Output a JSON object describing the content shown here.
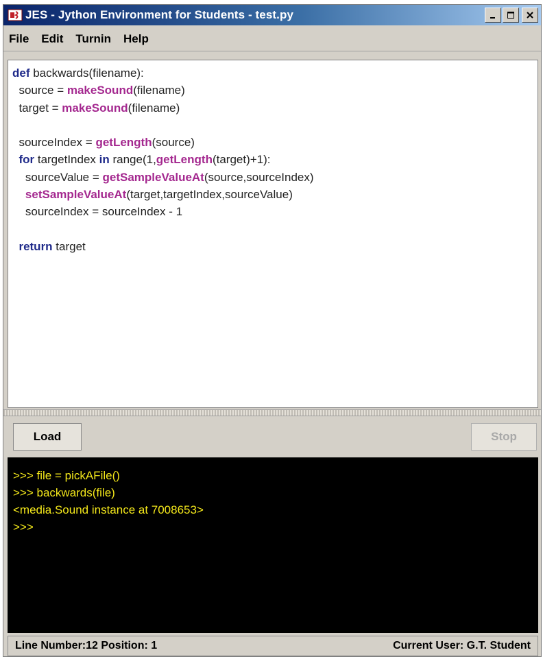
{
  "window": {
    "title": "JES - Jython Environment for Students - test.py",
    "controls": [
      "minimize-icon",
      "maximize-icon",
      "close-icon"
    ]
  },
  "menu": {
    "items": [
      {
        "label": "File"
      },
      {
        "label": "Edit"
      },
      {
        "label": "Turnin"
      },
      {
        "label": "Help"
      }
    ]
  },
  "editor": {
    "lines": [
      [
        {
          "t": "def",
          "s": "kw"
        },
        {
          "t": " backwards(filename):",
          "s": "n"
        }
      ],
      [
        {
          "t": "  source = ",
          "s": "n"
        },
        {
          "t": "makeSound",
          "s": "fn"
        },
        {
          "t": "(filename)",
          "s": "n"
        }
      ],
      [
        {
          "t": "  target = ",
          "s": "n"
        },
        {
          "t": "makeSound",
          "s": "fn"
        },
        {
          "t": "(filename)",
          "s": "n"
        }
      ],
      [
        {
          "t": "",
          "s": "n"
        }
      ],
      [
        {
          "t": "  sourceIndex = ",
          "s": "n"
        },
        {
          "t": "getLength",
          "s": "fn"
        },
        {
          "t": "(source)",
          "s": "n"
        }
      ],
      [
        {
          "t": "  ",
          "s": "n"
        },
        {
          "t": "for",
          "s": "kw"
        },
        {
          "t": " targetIndex ",
          "s": "n"
        },
        {
          "t": "in",
          "s": "kw"
        },
        {
          "t": " range(1,",
          "s": "n"
        },
        {
          "t": "getLength",
          "s": "fn"
        },
        {
          "t": "(target)+1):",
          "s": "n"
        }
      ],
      [
        {
          "t": "    sourceValue = ",
          "s": "n"
        },
        {
          "t": "getSampleValueAt",
          "s": "fn"
        },
        {
          "t": "(source,sourceIndex)",
          "s": "n"
        }
      ],
      [
        {
          "t": "    ",
          "s": "n"
        },
        {
          "t": "setSampleValueAt",
          "s": "fn"
        },
        {
          "t": "(target,targetIndex,sourceValue)",
          "s": "n"
        }
      ],
      [
        {
          "t": "    sourceIndex = sourceIndex - 1",
          "s": "n"
        }
      ],
      [
        {
          "t": "",
          "s": "n"
        }
      ],
      [
        {
          "t": "  ",
          "s": "n"
        },
        {
          "t": "return",
          "s": "kw"
        },
        {
          "t": " target",
          "s": "n"
        }
      ]
    ]
  },
  "buttons": {
    "load": "Load",
    "stop": "Stop"
  },
  "console": {
    "lines": [
      ">>> file = pickAFile()",
      ">>> backwards(file)",
      "<media.Sound instance at 7008653>",
      ">>>"
    ]
  },
  "status": {
    "position": "Line Number:12 Position: 1",
    "user": "Current User: G.T. Student"
  },
  "colors": {
    "keyword": "#1f2a8a",
    "function": "#a4288f",
    "console_text": "#f2e61a",
    "console_bg": "#000000",
    "title_bar": "#0a246a"
  }
}
